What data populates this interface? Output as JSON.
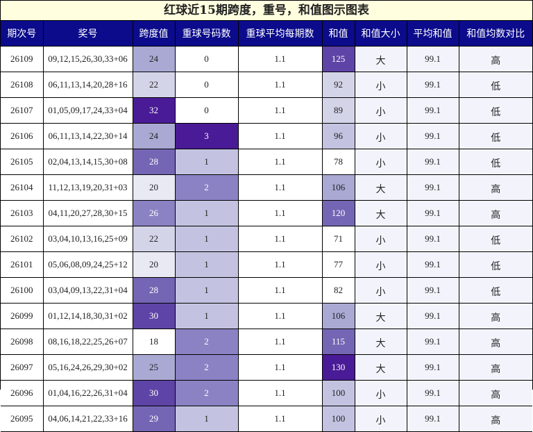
{
  "title": "红球近15期跨度，重号，和值图示图表",
  "columns": [
    "期次号",
    "奖号",
    "跨度值",
    "重球号码数",
    "重球平均每期数",
    "和值",
    "和值大小",
    "平均和值",
    "和值均数对比"
  ],
  "shade_colors": [
    "#ffffff",
    "#e9e9f4",
    "#d4d4e9",
    "#c3c3e1",
    "#a9a9d4",
    "#8b82c4",
    "#7466b4",
    "#5e44a6",
    "#4a1b96"
  ],
  "rows": [
    {
      "period": "26109",
      "numbers": "09,12,15,26,30,33+06",
      "span": "24",
      "repeat": "0",
      "repeat_avg": "1.1",
      "sum": "125",
      "size": "大",
      "avg_sum": "99.1",
      "compare": "高"
    },
    {
      "period": "26108",
      "numbers": "06,11,13,14,20,28+16",
      "span": "22",
      "repeat": "0",
      "repeat_avg": "1.1",
      "sum": "92",
      "size": "小",
      "avg_sum": "99.1",
      "compare": "低"
    },
    {
      "period": "26107",
      "numbers": "01,05,09,17,24,33+04",
      "span": "32",
      "repeat": "0",
      "repeat_avg": "1.1",
      "sum": "89",
      "size": "小",
      "avg_sum": "99.1",
      "compare": "低"
    },
    {
      "period": "26106",
      "numbers": "06,11,13,14,22,30+14",
      "span": "24",
      "repeat": "3",
      "repeat_avg": "1.1",
      "sum": "96",
      "size": "小",
      "avg_sum": "99.1",
      "compare": "低"
    },
    {
      "period": "26105",
      "numbers": "02,04,13,14,15,30+08",
      "span": "28",
      "repeat": "1",
      "repeat_avg": "1.1",
      "sum": "78",
      "size": "小",
      "avg_sum": "99.1",
      "compare": "低"
    },
    {
      "period": "26104",
      "numbers": "11,12,13,19,20,31+03",
      "span": "20",
      "repeat": "2",
      "repeat_avg": "1.1",
      "sum": "106",
      "size": "大",
      "avg_sum": "99.1",
      "compare": "高"
    },
    {
      "period": "26103",
      "numbers": "04,11,20,27,28,30+15",
      "span": "26",
      "repeat": "1",
      "repeat_avg": "1.1",
      "sum": "120",
      "size": "大",
      "avg_sum": "99.1",
      "compare": "高"
    },
    {
      "period": "26102",
      "numbers": "03,04,10,13,16,25+09",
      "span": "22",
      "repeat": "1",
      "repeat_avg": "1.1",
      "sum": "71",
      "size": "小",
      "avg_sum": "99.1",
      "compare": "低"
    },
    {
      "period": "26101",
      "numbers": "05,06,08,09,24,25+12",
      "span": "20",
      "repeat": "1",
      "repeat_avg": "1.1",
      "sum": "77",
      "size": "小",
      "avg_sum": "99.1",
      "compare": "低"
    },
    {
      "period": "26100",
      "numbers": "03,04,09,13,22,31+04",
      "span": "28",
      "repeat": "1",
      "repeat_avg": "1.1",
      "sum": "82",
      "size": "小",
      "avg_sum": "99.1",
      "compare": "低"
    },
    {
      "period": "26099",
      "numbers": "01,12,14,18,30,31+02",
      "span": "30",
      "repeat": "1",
      "repeat_avg": "1.1",
      "sum": "106",
      "size": "大",
      "avg_sum": "99.1",
      "compare": "高"
    },
    {
      "period": "26098",
      "numbers": "08,16,18,22,25,26+07",
      "span": "18",
      "repeat": "2",
      "repeat_avg": "1.1",
      "sum": "115",
      "size": "大",
      "avg_sum": "99.1",
      "compare": "高"
    },
    {
      "period": "26097",
      "numbers": "05,16,24,26,29,30+02",
      "span": "25",
      "repeat": "2",
      "repeat_avg": "1.1",
      "sum": "130",
      "size": "大",
      "avg_sum": "99.1",
      "compare": "高"
    },
    {
      "period": "26096",
      "numbers": "01,04,16,22,26,31+04",
      "span": "30",
      "repeat": "2",
      "repeat_avg": "1.1",
      "sum": "100",
      "size": "小",
      "avg_sum": "99.1",
      "compare": "高"
    },
    {
      "period": "26095",
      "numbers": "04,06,14,21,22,33+16",
      "span": "29",
      "repeat": "1",
      "repeat_avg": "1.1",
      "sum": "100",
      "size": "小",
      "avg_sum": "99.1",
      "compare": "高"
    }
  ]
}
